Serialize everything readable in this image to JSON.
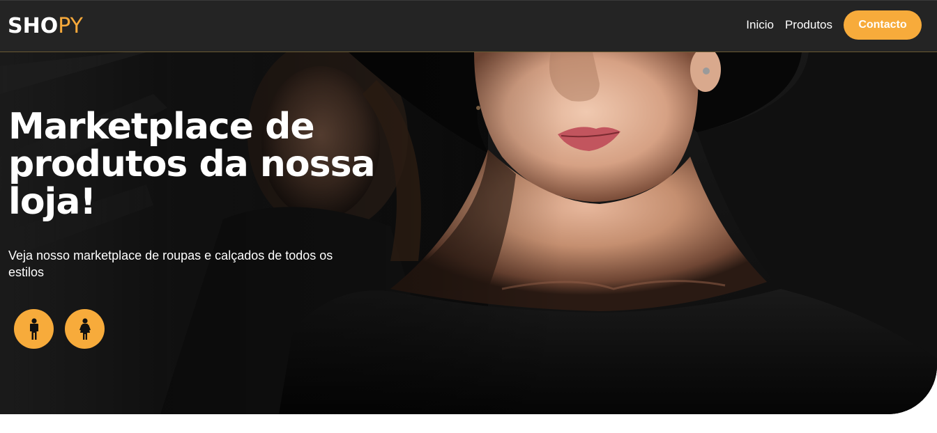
{
  "brand": {
    "logo_part1": "SHO",
    "logo_part2": "PY",
    "accent_color": "#f7ab3b",
    "header_bg": "#242424"
  },
  "nav": {
    "items": [
      {
        "label": "Inicio"
      },
      {
        "label": "Produtos"
      }
    ],
    "cta_label": "Contacto"
  },
  "hero": {
    "title": "Marketplace de produtos da nossa loja!",
    "subtitle": "Veja nosso marketplace de roupas e calçados de todos os estilos",
    "buttons": [
      {
        "icon": "male-person-icon"
      },
      {
        "icon": "female-person-icon"
      }
    ]
  }
}
